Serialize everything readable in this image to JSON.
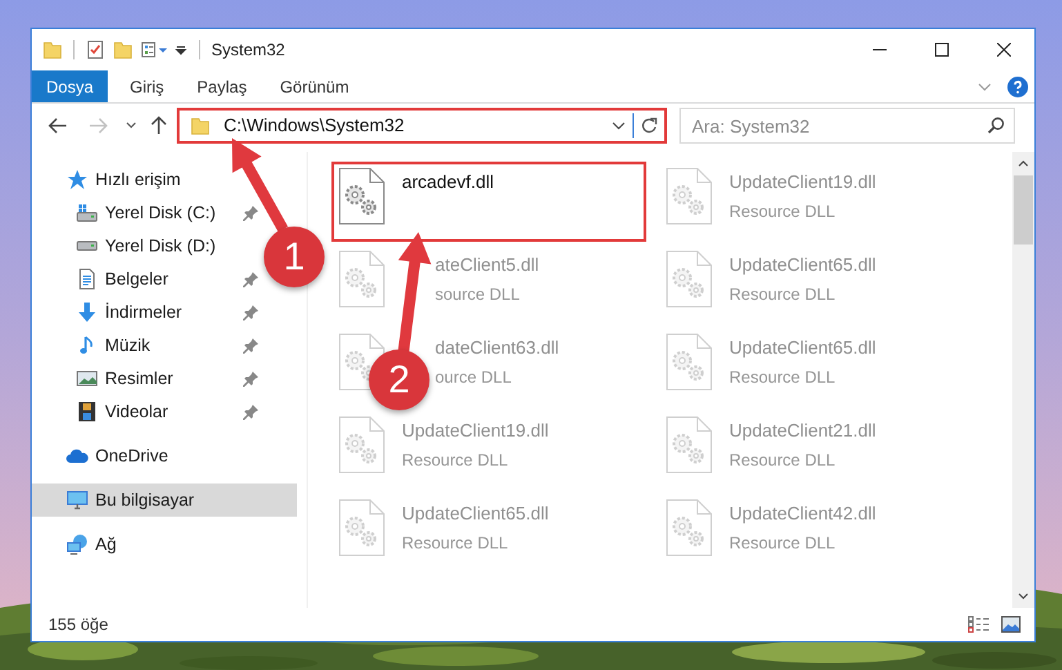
{
  "window": {
    "title": "System32"
  },
  "ribbon_tabs": [
    {
      "label": "Dosya",
      "selected": true
    },
    {
      "label": "Giriş",
      "selected": false
    },
    {
      "label": "Paylaş",
      "selected": false
    },
    {
      "label": "Görünüm",
      "selected": false
    }
  ],
  "address": {
    "path": "C:\\Windows\\System32",
    "emphasized": true
  },
  "search": {
    "placeholder": "Ara: System32"
  },
  "sidebar": {
    "items": [
      {
        "label": "Hızlı erişim",
        "kind": "quick-access",
        "selected": false,
        "children": [
          {
            "label": "Yerel Disk (C:)",
            "kind": "system-drive",
            "pinned": true
          },
          {
            "label": "Yerel Disk (D:)",
            "kind": "drive",
            "pinned": false
          },
          {
            "label": "Belgeler",
            "kind": "documents",
            "pinned": true
          },
          {
            "label": "İndirmeler",
            "kind": "downloads",
            "pinned": true
          },
          {
            "label": "Müzik",
            "kind": "music",
            "pinned": true
          },
          {
            "label": "Resimler",
            "kind": "pictures",
            "pinned": true
          },
          {
            "label": "Videolar",
            "kind": "videos",
            "pinned": true
          }
        ]
      },
      {
        "label": "OneDrive",
        "kind": "cloud",
        "selected": false
      },
      {
        "label": "Bu bilgisayar",
        "kind": "computer",
        "selected": true
      },
      {
        "label": "Ağ",
        "kind": "network",
        "selected": false
      }
    ]
  },
  "files": [
    {
      "name": "arcadevf.dll",
      "emphasized": true
    },
    {
      "name": "UpdateClient19.dll",
      "description": "Resource DLL",
      "emphasized": false
    },
    {
      "name": "ateClient5.dll",
      "description": "source DLL",
      "emphasized": false,
      "partly_hidden": true
    },
    {
      "name": "UpdateClient65.dll",
      "description": "Resource DLL",
      "emphasized": false
    },
    {
      "name": "dateClient63.dll",
      "description": "ource DLL",
      "emphasized": false,
      "partly_hidden": true
    },
    {
      "name": "UpdateClient65.dll",
      "description": "Resource DLL",
      "emphasized": false
    },
    {
      "name": "UpdateClient19.dll",
      "description": "Resource DLL",
      "emphasized": false
    },
    {
      "name": "UpdateClient21.dll",
      "description": "Resource DLL",
      "emphasized": false
    },
    {
      "name": "UpdateClient65.dll",
      "description": "Resource DLL",
      "emphasized": false
    },
    {
      "name": "UpdateClient42.dll",
      "description": "Resource DLL",
      "emphasized": false
    }
  ],
  "status_bar": {
    "count": "155 öğe"
  },
  "annotations": [
    {
      "label": "1"
    },
    {
      "label": "2"
    }
  ]
}
